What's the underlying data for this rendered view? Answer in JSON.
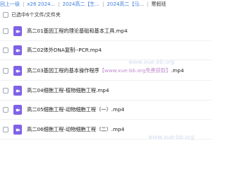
{
  "breadcrumb": {
    "items": [
      {
        "label": "回上一级"
      },
      {
        "label": "x26 2024..."
      },
      {
        "label": "2024高二【生..."
      },
      {
        "label": "2024高二【马..."
      },
      {
        "label": "寒假班"
      }
    ],
    "separator": "|"
  },
  "selection": {
    "label": "已选中6个文件/文件夹"
  },
  "files": [
    {
      "name": "高二01基因工程的理论基础和基本工具.mp4"
    },
    {
      "name": "高二02体外DNA复制--PCR.mp4"
    },
    {
      "name_prefix": "高二03基因工程的基本操作程序",
      "name_mark": "【www.xue-bb.org免费获取】",
      "name_suffix": ".mp4"
    },
    {
      "name": "高二04细胞工程-植物细胞工程.mp4"
    },
    {
      "name": "高二05细胞工程-动物细胞工程（一）.mp4"
    },
    {
      "name": "高二06细胞工程-动物细胞工程（二）.mp4"
    }
  ],
  "watermarks": [
    "www.xue-bb.org",
    "www.xue-bb.org"
  ],
  "colors": {
    "link": "#3b7ddd",
    "video_icon": "#7f62e8"
  }
}
